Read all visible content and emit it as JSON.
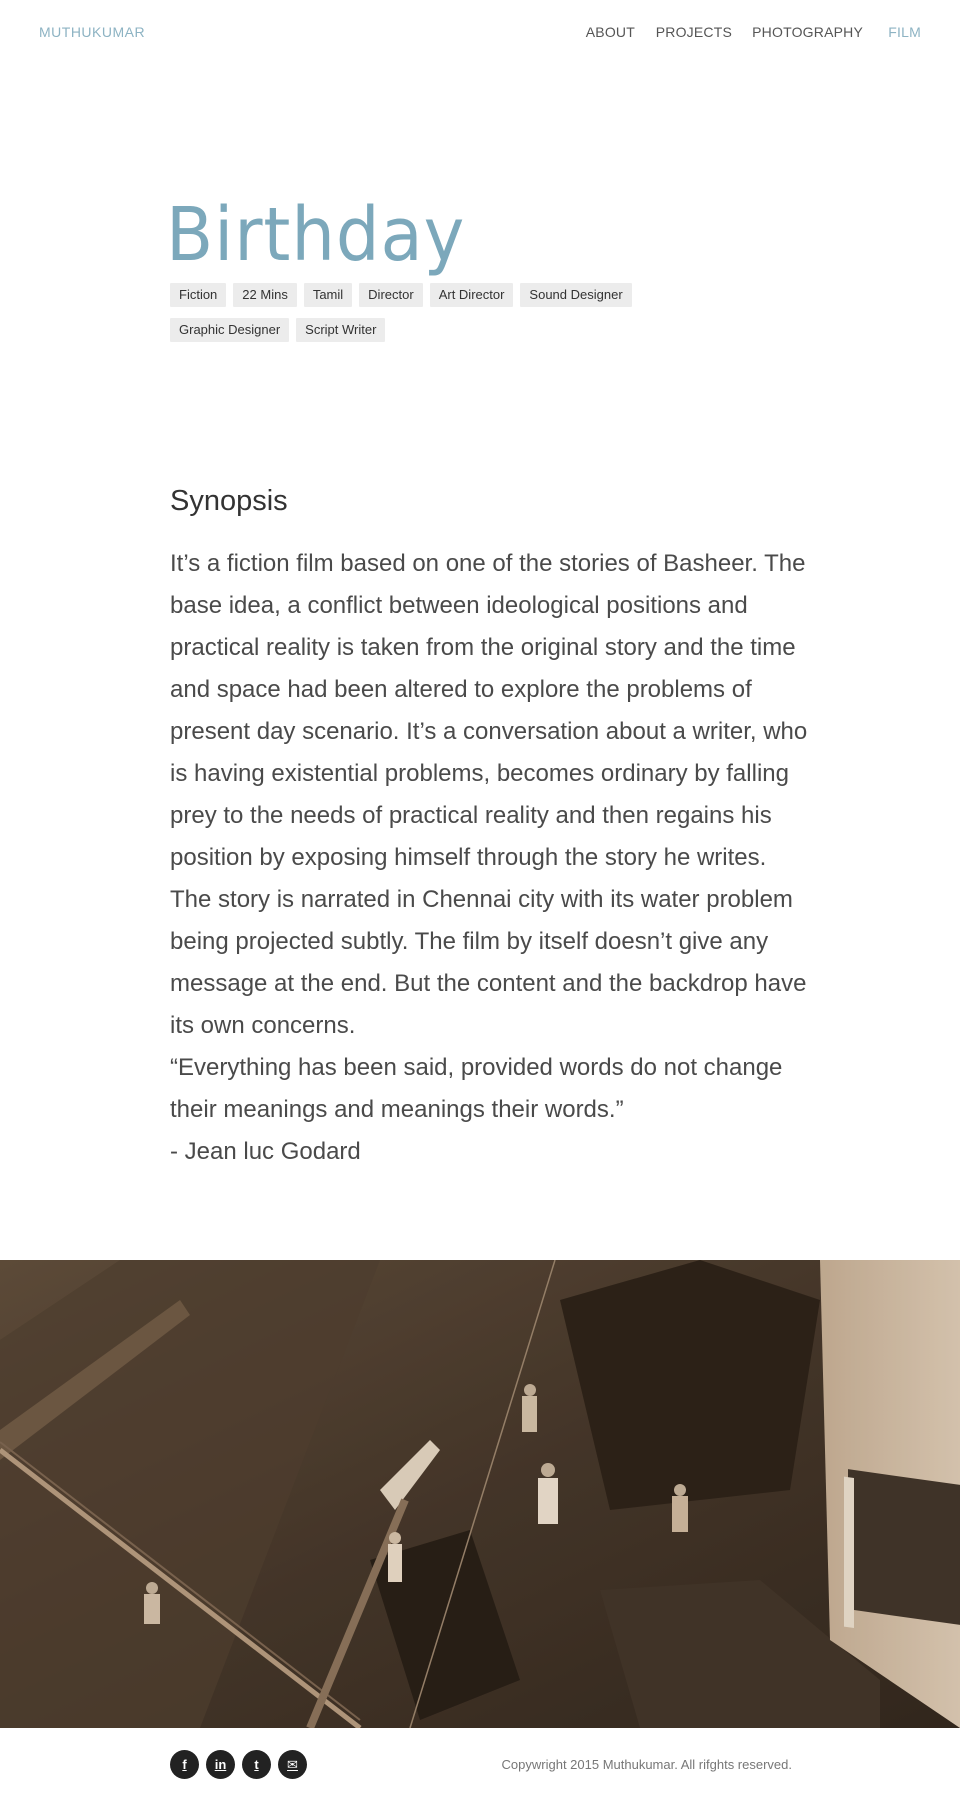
{
  "header": {
    "brand": "MUTHUKUMAR",
    "nav": [
      {
        "label": "ABOUT",
        "active": false
      },
      {
        "label": "PROJECTS",
        "active": false
      },
      {
        "label": "PHOTOGRAPHY",
        "active": false
      },
      {
        "label": "FILM",
        "active": true
      }
    ]
  },
  "film": {
    "title": "Birthday",
    "tags": [
      "Fiction",
      "22 Mins",
      "Tamil",
      "Director",
      "Art Director",
      "Sound Designer",
      "Graphic Designer",
      "Script Writer"
    ]
  },
  "synopsis": {
    "heading": "Synopsis",
    "body": "It’s a fiction film based on one of the stories of Basheer. The base idea, a conflict between ideological positions and practical reality is taken from the original story and the time and space had been altered to explore the problems of present day scenario. It’s a conversation about a writer, who is having existential problems, becomes ordinary by falling prey to the needs of practical reality and then regains his position by exposing himself through the story he writes. The story is narrated in Chennai city with its water problem being projected subtly. The film by itself doesn’t give any message at the end. But the content and the backdrop have its own concerns.",
    "quote": "“Everything has been said, provided words do not change their meanings and meanings their words.”",
    "attribution": "- Jean luc Godard"
  },
  "footer": {
    "socials": [
      {
        "icon": "facebook-icon",
        "glyph": "f"
      },
      {
        "icon": "linkedin-icon",
        "glyph": "in"
      },
      {
        "icon": "twitter-icon",
        "glyph": "t"
      },
      {
        "icon": "email-icon",
        "glyph": "✉"
      }
    ],
    "copyright": "Copywright 2015 Muthukumar. All rifghts reserved."
  },
  "colors": {
    "accent": "#7ca8bb",
    "tag_bg": "#ececec",
    "social_bg": "#222222"
  }
}
